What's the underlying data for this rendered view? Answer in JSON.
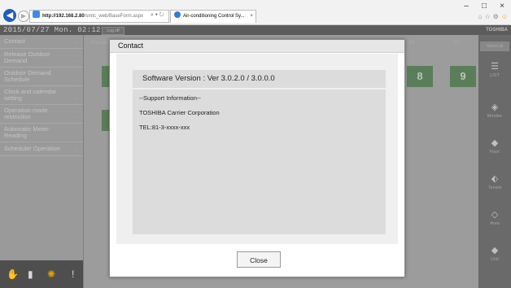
{
  "browser": {
    "url_host": "http://192.168.2.80",
    "url_path": "/smtc_web/BaseForm.aspx",
    "address_actions": "⌕ ▾ ↻",
    "tab_title": "Air-conditioning Control Sy...",
    "tab_close": "×",
    "window_controls": [
      "–",
      "□",
      "×"
    ],
    "toolbar_icons": [
      "⌂",
      "☆",
      "⚙",
      "☺"
    ]
  },
  "app": {
    "datetime": "2015/07/27 Mon. 02:12",
    "logout_label": "Log off",
    "brand": "TOSHIBA",
    "search_placeholder": "Select all",
    "sidebar": {
      "items": [
        {
          "label": "Contact"
        },
        {
          "label": "Release Outdoor Demand"
        },
        {
          "label": "Outdoor Demand Schedule"
        },
        {
          "label": "Clock and calendar setting"
        },
        {
          "label": "Operation mode restriction"
        },
        {
          "label": "Automatic Meter-Reading"
        },
        {
          "label": "Scheduler Operation"
        }
      ],
      "bottom_icons": [
        "hand-icon",
        "book-icon",
        "sun-icon",
        "alert-icon"
      ]
    },
    "tiles": [
      {
        "header": "TOSHIBA Build...",
        "value": ""
      },
      {
        "header": "8 F",
        "value": "8"
      },
      {
        "header": "9 F",
        "value": "9"
      }
    ],
    "rightbar": {
      "items": [
        {
          "label": "LIST",
          "icon": "list-icon"
        },
        {
          "label": "Monitor",
          "icon": "monitor-icon"
        },
        {
          "label": "Floor",
          "icon": "floor-icon"
        },
        {
          "label": "Tenant",
          "icon": "tenant-icon"
        },
        {
          "label": "Area",
          "icon": "area-icon"
        },
        {
          "label": "Unit",
          "icon": "unit-icon"
        }
      ]
    }
  },
  "dialog": {
    "title": "Contact",
    "version": "Software Version : Ver 3.0.2.0 / 3.0.0.0",
    "support_header": "--Support Information--",
    "company": "TOSHIBA Carrier Corporation",
    "tel": "TEL:81-3-xxxx-xxx",
    "close_label": "Close"
  }
}
